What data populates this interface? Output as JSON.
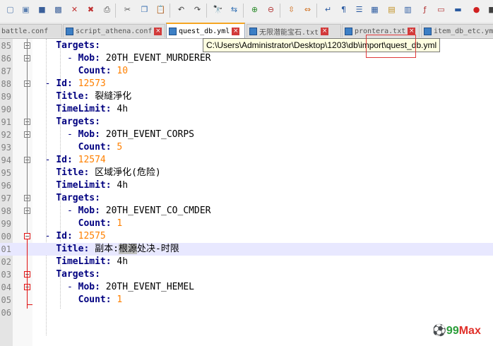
{
  "toolbar": {
    "buttons": [
      {
        "name": "new-file-icon",
        "glyph": "▢",
        "color": "#5a7fb0"
      },
      {
        "name": "open-file-icon",
        "glyph": "▣",
        "color": "#5a7fb0"
      },
      {
        "name": "save-icon",
        "glyph": "■",
        "color": "#3a5f9a"
      },
      {
        "name": "save-all-icon",
        "glyph": "▩",
        "color": "#3a5f9a"
      },
      {
        "name": "close-icon",
        "glyph": "✕",
        "color": "#c03030"
      },
      {
        "name": "close-all-icon",
        "glyph": "✖",
        "color": "#c03030"
      },
      {
        "name": "print-icon",
        "glyph": "⎙",
        "color": "#444444"
      },
      {
        "name": "cut-icon",
        "glyph": "✂",
        "color": "#555555"
      },
      {
        "name": "copy-icon",
        "glyph": "❐",
        "color": "#3a6fb0"
      },
      {
        "name": "paste-icon",
        "glyph": "📋",
        "color": "#7a5a30"
      },
      {
        "name": "undo-icon",
        "glyph": "↶",
        "color": "#404040"
      },
      {
        "name": "redo-icon",
        "glyph": "↷",
        "color": "#404040"
      },
      {
        "name": "find-icon",
        "glyph": "🔭",
        "color": "#303030"
      },
      {
        "name": "replace-icon",
        "glyph": "⇆",
        "color": "#2a6ab0"
      },
      {
        "name": "zoom-in-icon",
        "glyph": "⊕",
        "color": "#2a8a2a"
      },
      {
        "name": "zoom-out-icon",
        "glyph": "⊖",
        "color": "#b03030"
      },
      {
        "name": "sync-vertical-icon",
        "glyph": "⇳",
        "color": "#d07020"
      },
      {
        "name": "sync-horizontal-icon",
        "glyph": "⇔",
        "color": "#d07020"
      },
      {
        "name": "word-wrap-icon",
        "glyph": "↵",
        "color": "#2a5aa0"
      },
      {
        "name": "show-all-chars-icon",
        "glyph": "¶",
        "color": "#2a5aa0"
      },
      {
        "name": "indent-guide-icon",
        "glyph": "☰",
        "color": "#2a5aa0"
      },
      {
        "name": "user-language-icon",
        "glyph": "▦",
        "color": "#2a5aa0"
      },
      {
        "name": "doc-map-icon",
        "glyph": "▤",
        "color": "#c09020"
      },
      {
        "name": "function-list-icon",
        "glyph": "▥",
        "color": "#2a5aa0"
      },
      {
        "name": "folder-workspace-icon",
        "glyph": "ƒ",
        "color": "#b03030"
      },
      {
        "name": "monitoring-icon",
        "glyph": "▭",
        "color": "#b03030"
      },
      {
        "name": "macro-icon",
        "glyph": "▬",
        "color": "#2a5aa0"
      },
      {
        "name": "record-macro-icon",
        "glyph": "●",
        "color": "#d02020"
      },
      {
        "name": "stop-record-icon",
        "glyph": "■",
        "color": "#404040"
      }
    ]
  },
  "tabs": [
    {
      "label": "battle.conf",
      "active": false
    },
    {
      "label": "script_athena.conf",
      "active": false
    },
    {
      "label": "quest_db.yml",
      "active": true
    },
    {
      "label": "无限潜能宝石.txt",
      "active": false
    },
    {
      "label": "prontera.txt",
      "active": false
    },
    {
      "label": "item_db_etc.ym",
      "active": false
    }
  ],
  "tooltip": {
    "path": "C:\\Users\\Administrator\\Desktop\\1203\\db\\import\\quest_db.yml"
  },
  "editor": {
    "lines": [
      {
        "num": "85",
        "indent": "    ",
        "key": "Targets:",
        "value": "",
        "type": "key"
      },
      {
        "num": "86",
        "indent": "      - ",
        "key": "Mob:",
        "value": "20TH_EVENT_MURDERER",
        "type": "text"
      },
      {
        "num": "87",
        "indent": "        ",
        "key": "Count:",
        "value": "10",
        "type": "number"
      },
      {
        "num": "88",
        "indent": "  - ",
        "key": "Id:",
        "value": "12573",
        "type": "number"
      },
      {
        "num": "89",
        "indent": "    ",
        "key": "Title:",
        "value": "裂縫淨化",
        "type": "text"
      },
      {
        "num": "90",
        "indent": "    ",
        "key": "TimeLimit:",
        "value": "4h",
        "type": "text"
      },
      {
        "num": "91",
        "indent": "    ",
        "key": "Targets:",
        "value": "",
        "type": "key"
      },
      {
        "num": "92",
        "indent": "      - ",
        "key": "Mob:",
        "value": "20TH_EVENT_CORPS",
        "type": "text"
      },
      {
        "num": "93",
        "indent": "        ",
        "key": "Count:",
        "value": "5",
        "type": "number"
      },
      {
        "num": "94",
        "indent": "  - ",
        "key": "Id:",
        "value": "12574",
        "type": "number"
      },
      {
        "num": "95",
        "indent": "    ",
        "key": "Title:",
        "value": "区域淨化(危险)",
        "type": "text"
      },
      {
        "num": "96",
        "indent": "    ",
        "key": "TimeLimit:",
        "value": "4h",
        "type": "text"
      },
      {
        "num": "97",
        "indent": "    ",
        "key": "Targets:",
        "value": "",
        "type": "key"
      },
      {
        "num": "98",
        "indent": "      - ",
        "key": "Mob:",
        "value": "20TH_EVENT_CO_CMDER",
        "type": "text"
      },
      {
        "num": "99",
        "indent": "        ",
        "key": "Count:",
        "value": "1",
        "type": "number"
      },
      {
        "num": "00",
        "indent": "  - ",
        "key": "Id:",
        "value": "12575",
        "type": "number"
      },
      {
        "num": "01",
        "indent": "    ",
        "key": "Title:",
        "value": "副本:根源处决-时限",
        "type": "text",
        "current": true
      },
      {
        "num": "02",
        "indent": "    ",
        "key": "TimeLimit:",
        "value": "4h",
        "type": "text"
      },
      {
        "num": "03",
        "indent": "    ",
        "key": "Targets:",
        "value": "",
        "type": "key"
      },
      {
        "num": "04",
        "indent": "      - ",
        "key": "Mob:",
        "value": "20TH_EVENT_HEMEL",
        "type": "text"
      },
      {
        "num": "05",
        "indent": "        ",
        "key": "Count:",
        "value": "1",
        "type": "number"
      },
      {
        "num": "06",
        "indent": "",
        "key": "",
        "value": "",
        "type": "empty"
      }
    ],
    "selection": {
      "line_index": 16,
      "prefix": "副本:",
      "selected": "根源",
      "suffix": "处决-时限"
    }
  },
  "watermark": {
    "text_green": "99",
    "text_red": "Max"
  }
}
